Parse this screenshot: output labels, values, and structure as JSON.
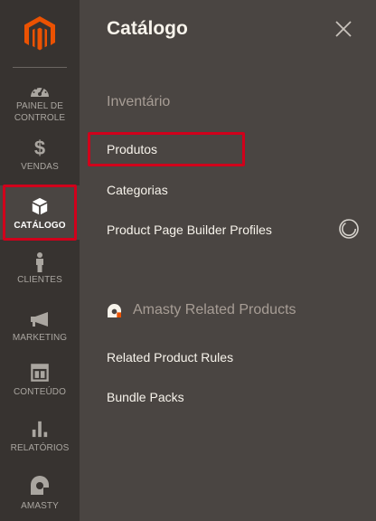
{
  "sidebar": {
    "items": [
      {
        "id": "dashboard",
        "label_line1": "PAINEL DE",
        "label_line2": "CONTROLE",
        "icon": "dashboard-icon"
      },
      {
        "id": "sales",
        "label": "VENDAS",
        "icon": "dollar-icon"
      },
      {
        "id": "catalog",
        "label": "CATÁLOGO",
        "icon": "box-icon",
        "active": true
      },
      {
        "id": "customers",
        "label": "CLIENTES",
        "icon": "person-icon"
      },
      {
        "id": "marketing",
        "label": "MARKETING",
        "icon": "megaphone-icon"
      },
      {
        "id": "content",
        "label": "CONTEÚDO",
        "icon": "layout-icon"
      },
      {
        "id": "reports",
        "label": "RELATÓRIOS",
        "icon": "bar-chart-icon"
      },
      {
        "id": "amasty",
        "label": "AMASTY",
        "icon": "amasty-icon"
      }
    ]
  },
  "panel": {
    "title": "Catálogo",
    "sections": [
      {
        "title": "Inventário",
        "links": [
          "Produtos",
          "Categorias",
          "Product Page Builder Profiles"
        ]
      },
      {
        "title": "Amasty Related Products",
        "icon": "amasty-icon",
        "links": [
          "Related Product Rules",
          "Bundle Packs"
        ]
      }
    ]
  },
  "colors": {
    "sidebar_bg": "#373330",
    "panel_bg": "#4a4542",
    "brand_orange": "#eb5202",
    "highlight_red": "#d0001b"
  }
}
